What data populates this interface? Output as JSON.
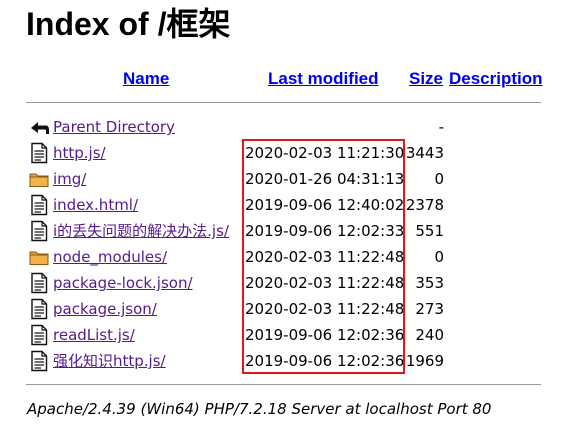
{
  "page_title": "Index of /框架",
  "columns": {
    "name": "Name",
    "last_modified": "Last modified",
    "size": "Size",
    "description": "Description"
  },
  "parent": {
    "label": "Parent Directory",
    "size": "-",
    "icon": "back-arrow-icon"
  },
  "entries": [
    {
      "name": "http.js/",
      "date": "2020-02-03 11:21:30",
      "size": "3443",
      "icon": "file-icon"
    },
    {
      "name": "img/",
      "date": "2020-01-26 04:31:13",
      "size": "0",
      "icon": "folder-icon"
    },
    {
      "name": "index.html/",
      "date": "2019-09-06 12:40:02",
      "size": "2378",
      "icon": "file-icon"
    },
    {
      "name": "i的丢失问题的解决办法.js/",
      "date": "2019-09-06 12:02:33",
      "size": "551",
      "icon": "file-icon"
    },
    {
      "name": "node_modules/",
      "date": "2020-02-03 11:22:48",
      "size": "0",
      "icon": "folder-icon"
    },
    {
      "name": "package-lock.json/",
      "date": "2020-02-03 11:22:48",
      "size": "353",
      "icon": "file-icon"
    },
    {
      "name": "package.json/",
      "date": "2020-02-03 11:22:48",
      "size": "273",
      "icon": "file-icon"
    },
    {
      "name": "readList.js/",
      "date": "2019-09-06 12:02:36",
      "size": "240",
      "icon": "file-icon"
    },
    {
      "name": "强化知识http.js/",
      "date": "2019-09-06 12:02:36",
      "size": "1969",
      "icon": "file-icon"
    }
  ],
  "server_signature": "Apache/2.4.39 (Win64) PHP/7.2.18 Server at localhost Port 80",
  "colors": {
    "link": "#0000ee",
    "visited_link": "#551a8b",
    "highlight_box": "#e01818",
    "rule": "#9a9a9a"
  }
}
